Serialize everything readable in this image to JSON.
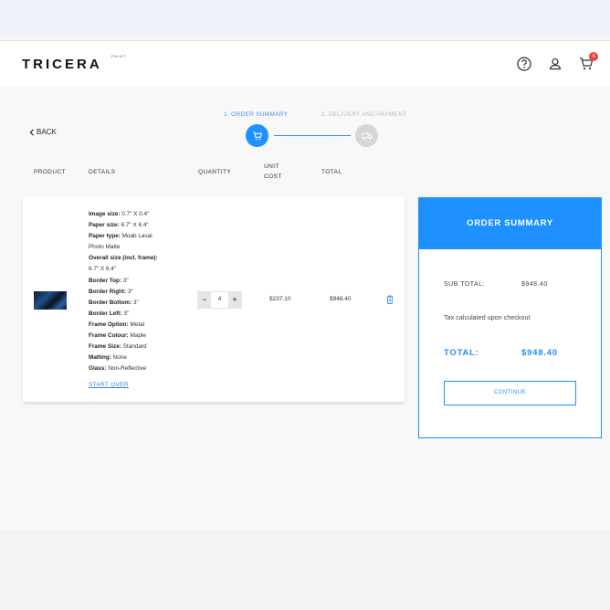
{
  "brand": {
    "name": "TRICERA",
    "sub": "PAINT"
  },
  "header": {
    "cart_count": "4"
  },
  "nav": {
    "back_label": "BACK"
  },
  "steps": [
    {
      "label": "1. ORDER SUMMARY",
      "active": true
    },
    {
      "label": "2. DELIVERY AND PAYMENT",
      "active": false
    }
  ],
  "columns": {
    "product": "PRODUCT",
    "details": "DETAILS",
    "quantity": "QUANTITY",
    "unit_cost_1": "UNIT",
    "unit_cost_2": "COST",
    "total": "TOTAL"
  },
  "item": {
    "details": [
      {
        "label": "Image size:",
        "value": " 0.7\" X 0.4\""
      },
      {
        "label": "Paper size:",
        "value": " 6.7\" X 6.4\""
      },
      {
        "label": "Paper type:",
        "value": " Moab Lasal"
      },
      {
        "label": "",
        "value": "Photo Matte"
      },
      {
        "label": "Overall size (incl. frame):",
        "value": ""
      },
      {
        "label": "",
        "value": "6.7\" X 6.4\""
      },
      {
        "label": "Border Top:",
        "value": " 3\""
      },
      {
        "label": "Border Right:",
        "value": " 3\""
      },
      {
        "label": "Border Bottom:",
        "value": " 3\""
      },
      {
        "label": "Border Left:",
        "value": " 3\""
      },
      {
        "label": "Frame Option:",
        "value": " Metal"
      },
      {
        "label": "Frame Colour:",
        "value": " Maple"
      },
      {
        "label": "Frame Size:",
        "value": " Standard"
      },
      {
        "label": "Matting:",
        "value": " None"
      },
      {
        "label": "Glass:",
        "value": " Non-Reflective"
      }
    ],
    "start_over": "START OVER",
    "quantity": "4",
    "minus": "−",
    "plus": "+",
    "unit_cost": "$237.10",
    "total": "$948.40"
  },
  "summary": {
    "title": "ORDER SUMMARY",
    "subtotal_label": "SUB TOTAL:",
    "subtotal_value": "$948.40",
    "tax_note": "Tax calculated upon checkout",
    "total_label": "TOTAL:",
    "total_value": "$948.40",
    "continue_label": "CONTINUE"
  },
  "colors": {
    "accent": "#1e90ff",
    "badge": "#f0433a",
    "inactive": "#d6d6d6"
  },
  "icons": [
    "help-icon",
    "user-icon",
    "cart-icon",
    "chevron-left-icon",
    "cart-step-icon",
    "truck-icon",
    "trash-icon"
  ]
}
